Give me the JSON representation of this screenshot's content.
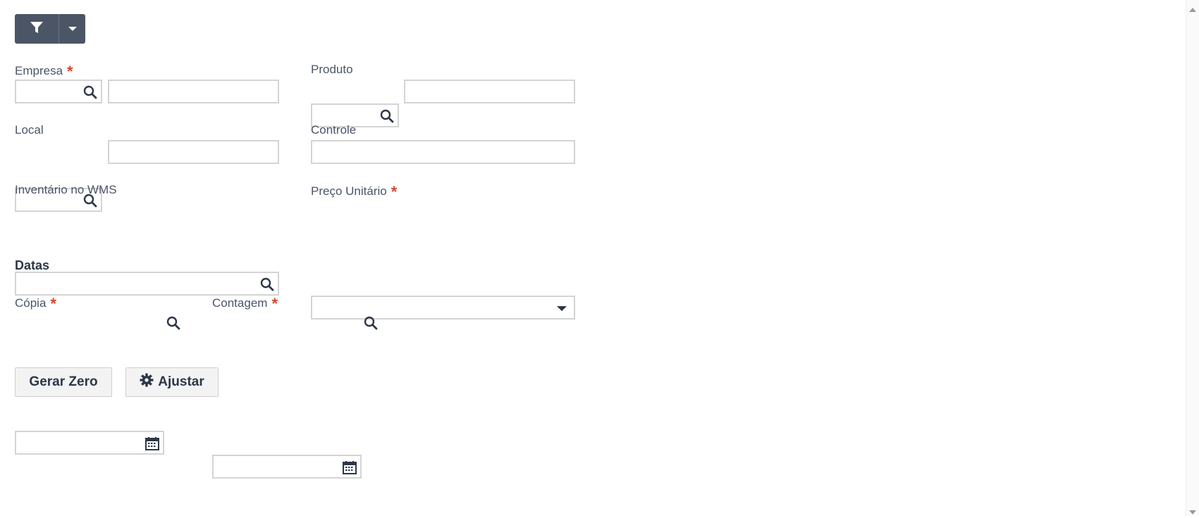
{
  "toolbar": {
    "filter_icon": "filter-icon",
    "dropdown_icon": "caret-down-icon"
  },
  "form": {
    "empresa": {
      "label": "Empresa",
      "required": "*",
      "code": "",
      "description": ""
    },
    "produto": {
      "label": "Produto",
      "code": "",
      "description": ""
    },
    "local": {
      "label": "Local",
      "code": "",
      "description": ""
    },
    "controle": {
      "label": "Controle",
      "value": ""
    },
    "inventario": {
      "label": "Inventário no WMS",
      "value": ""
    },
    "preco": {
      "label": "Preço Unitário",
      "required": "*",
      "selected": ""
    }
  },
  "datas": {
    "title": "Datas",
    "copia": {
      "label": "Cópia",
      "required": "*",
      "value": ""
    },
    "contagem": {
      "label": "Contagem",
      "required": "*",
      "value": ""
    }
  },
  "actions": {
    "gerar_zero": "Gerar Zero",
    "ajustar": "Ajustar"
  },
  "colors": {
    "accent": "#4b5565",
    "required": "#d9452b",
    "border": "#d4d4d4"
  }
}
